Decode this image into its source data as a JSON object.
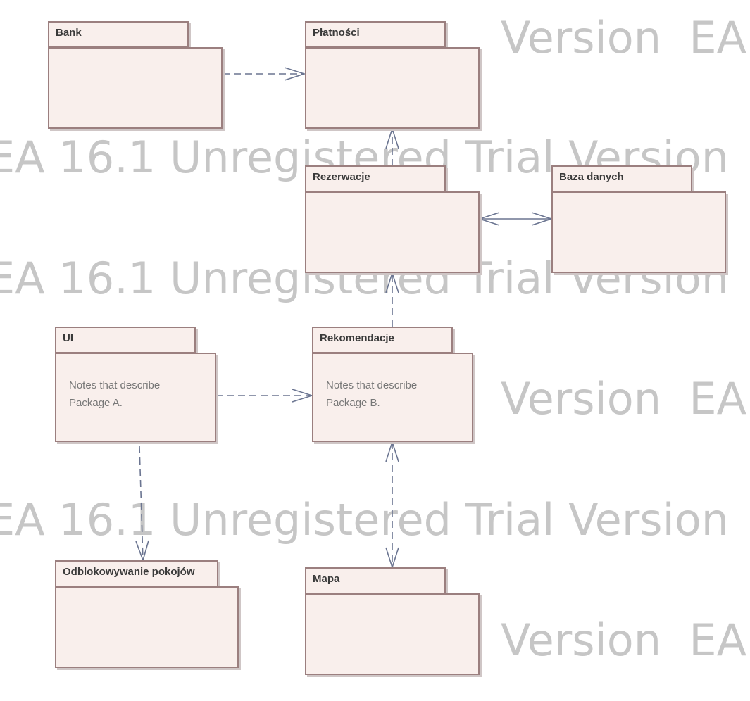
{
  "watermark": {
    "full_text": "EA 16.1 Unregistered Trial Version  EA",
    "short_text": "Version  EA"
  },
  "colors": {
    "package_fill": "#f9efec",
    "package_border": "#9b7f7f",
    "connector": "#6b7591",
    "watermark": "#c6c6c6"
  },
  "packages": {
    "bank": {
      "name": "Bank",
      "notes": ""
    },
    "platnosci": {
      "name": "Płatności",
      "notes": ""
    },
    "rezerwacje": {
      "name": "Rezerwacje",
      "notes": ""
    },
    "baza": {
      "name": "Baza danych",
      "notes": ""
    },
    "ui": {
      "name": "UI",
      "notes": "Notes that describe\nPackage A."
    },
    "rekomendacje": {
      "name": "Rekomendacje",
      "notes": "Notes that describe\nPackage B."
    },
    "odblokowywanie": {
      "name": "Odblokowywanie pokojów",
      "notes": ""
    },
    "mapa": {
      "name": "Mapa",
      "notes": ""
    }
  },
  "dependencies": [
    {
      "from": "Bank",
      "to": "Płatności",
      "style": "dashed",
      "direction": "forward"
    },
    {
      "from": "Rezerwacje",
      "to": "Płatności",
      "style": "dashed",
      "direction": "forward"
    },
    {
      "from": "Rezerwacje",
      "to": "Baza danych",
      "style": "solid",
      "direction": "both"
    },
    {
      "from": "Rekomendacje",
      "to": "Rezerwacje",
      "style": "dashed",
      "direction": "forward"
    },
    {
      "from": "UI",
      "to": "Rekomendacje",
      "style": "dashed",
      "direction": "forward"
    },
    {
      "from": "UI",
      "to": "Odblokowywanie pokojów",
      "style": "dashed",
      "direction": "forward"
    },
    {
      "from": "Rekomendacje",
      "to": "Mapa",
      "style": "dashed",
      "direction": "both"
    }
  ]
}
